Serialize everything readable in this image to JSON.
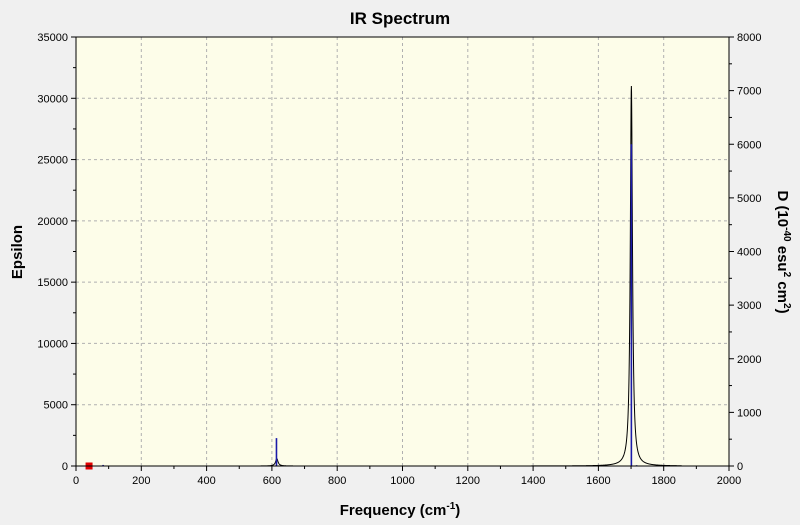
{
  "chart_data": {
    "type": "line",
    "title": "IR Spectrum",
    "xlabel": "Frequency (cm",
    "xlabel_sup": "-1",
    "xlabel_end": ")",
    "ylabel": "Epsilon",
    "y2label_parts": [
      "D (10",
      "-40",
      " esu",
      "2",
      " cm",
      "2",
      ")"
    ],
    "xlim": [
      0,
      2000
    ],
    "ylim": [
      0,
      35000
    ],
    "y2lim": [
      0,
      8000
    ],
    "xticks": [
      0,
      200,
      400,
      600,
      800,
      1000,
      1200,
      1400,
      1600,
      1800,
      2000
    ],
    "yticks": [
      0,
      5000,
      10000,
      15000,
      20000,
      25000,
      30000,
      35000
    ],
    "y2ticks": [
      0,
      1000,
      2000,
      3000,
      4000,
      5000,
      6000,
      7000,
      8000
    ],
    "grid": true,
    "series": [
      {
        "kind": "lorentzian-spectrum",
        "baseline": 0,
        "peaks": [
          {
            "x": 615,
            "height": 600,
            "hwhm": 4.5
          },
          {
            "x": 1701,
            "height": 31000,
            "hwhm": 4.0
          }
        ],
        "x_range": [
          80,
          1855
        ]
      },
      {
        "kind": "stick",
        "sticks": [
          {
            "x": 83,
            "d": 20
          },
          {
            "x": 614,
            "d": 520
          },
          {
            "x": 1701,
            "d": 6000
          },
          {
            "x": 1717,
            "d": 15
          }
        ]
      }
    ],
    "marker": {
      "x": 40,
      "y": 0
    }
  },
  "colors": {
    "background": "#f0f0f0",
    "plot_background": "#fdfde9",
    "spectrum_line": "#000000",
    "stick_line": "#1a1aa8",
    "grid": "#b0b0b0",
    "marker": "#e00000"
  }
}
